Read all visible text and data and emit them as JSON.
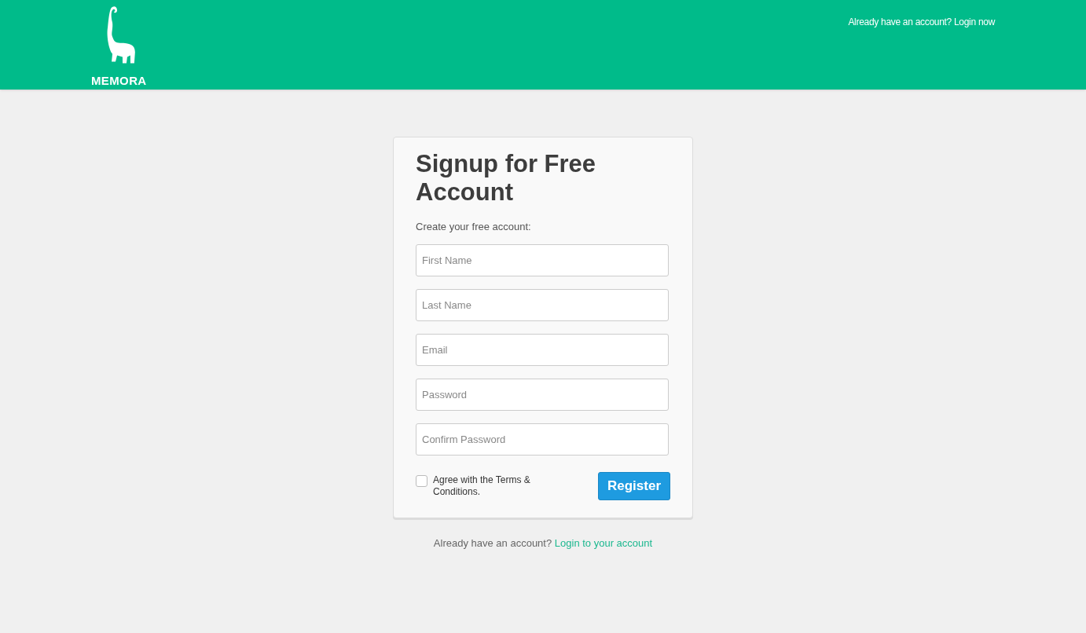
{
  "header": {
    "brand": "MEMORA",
    "login_link": "Already have an account? Login now"
  },
  "form": {
    "title": "Signup for Free Account",
    "subtitle": "Create your free account:",
    "fields": [
      {
        "placeholder": "First Name"
      },
      {
        "placeholder": "Last Name"
      },
      {
        "placeholder": "Email"
      },
      {
        "placeholder": "Password"
      },
      {
        "placeholder": "Confirm Password"
      }
    ],
    "terms": {
      "label": "Agree with the Terms & Conditions.",
      "checked": false
    },
    "submit": "Register"
  },
  "footer": {
    "text": "Already have an account?",
    "link": "Login to your account"
  }
}
